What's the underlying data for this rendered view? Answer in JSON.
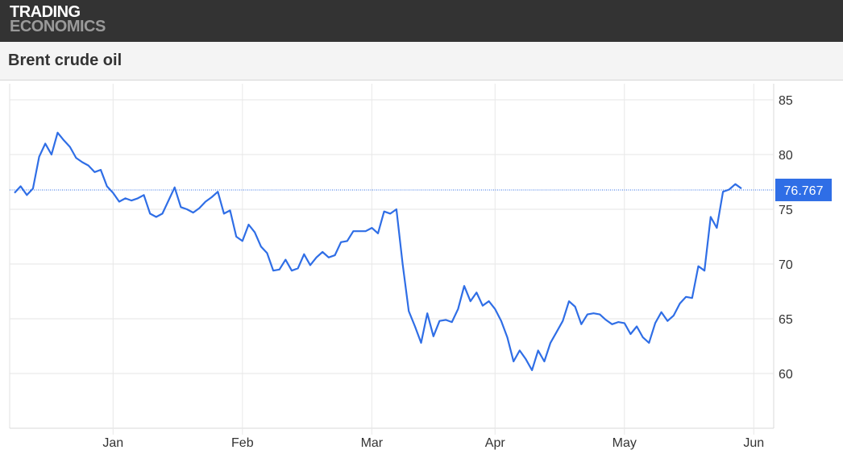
{
  "header": {
    "logo_line1": "TRADING",
    "logo_line2": "ECONOMICS",
    "title": "Brent crude oil"
  },
  "colors": {
    "line": "#2f6ee6",
    "last_label_bg": "#2f6ee6",
    "grid": "#e6e6e6",
    "topbar": "#333333"
  },
  "chart_data": {
    "type": "line",
    "title": "Brent crude oil",
    "xlabel": "",
    "ylabel": "",
    "ylim": [
      55,
      86
    ],
    "yticks": [
      60,
      65,
      70,
      75,
      80,
      85
    ],
    "ytick_labels": [
      "60",
      "65",
      "70",
      "75",
      "80",
      "85"
    ],
    "xticks": [
      {
        "label": "Jan",
        "index": 16
      },
      {
        "label": "Feb",
        "index": 37
      },
      {
        "label": "Mar",
        "index": 58
      },
      {
        "label": "Apr",
        "index": 78
      },
      {
        "label": "May",
        "index": 99
      },
      {
        "label": "Jun",
        "index": 120
      }
    ],
    "grid": true,
    "last_value": 76.767,
    "last_value_label": "76.767",
    "series": [
      {
        "values": [
          76.5,
          77.1,
          76.3,
          76.9,
          79.8,
          81.0,
          80.0,
          82.0,
          81.3,
          80.7,
          79.7,
          79.3,
          79.0,
          78.4,
          78.6,
          77.1,
          76.5,
          75.7,
          76.0,
          75.8,
          76.0,
          76.3,
          74.6,
          74.3,
          74.6,
          75.8,
          77.0,
          75.2,
          75.0,
          74.7,
          75.1,
          75.7,
          76.1,
          76.6,
          74.6,
          74.9,
          72.5,
          72.1,
          73.6,
          72.9,
          71.6,
          71.0,
          69.4,
          69.5,
          70.4,
          69.4,
          69.6,
          70.9,
          69.9,
          70.6,
          71.1,
          70.6,
          70.8,
          72.0,
          72.1,
          73.0,
          73.0,
          73.0,
          73.3,
          72.8,
          74.8,
          74.6,
          75.0,
          70.0,
          65.7,
          64.3,
          62.8,
          65.5,
          63.4,
          64.8,
          64.9,
          64.7,
          65.9,
          68.0,
          66.6,
          67.4,
          66.2,
          66.6,
          65.9,
          64.8,
          63.3,
          61.1,
          62.1,
          61.3,
          60.3,
          62.1,
          61.1,
          62.8,
          63.8,
          64.8,
          66.6,
          66.1,
          64.5,
          65.4,
          65.5,
          65.4,
          64.9,
          64.5,
          64.7,
          64.6,
          63.6,
          64.3,
          63.3,
          62.8,
          64.6,
          65.6,
          64.8,
          65.3,
          66.4,
          67.0,
          66.9,
          69.8,
          69.4,
          74.3,
          73.3,
          76.6,
          76.8,
          77.3,
          76.9
        ]
      }
    ]
  }
}
